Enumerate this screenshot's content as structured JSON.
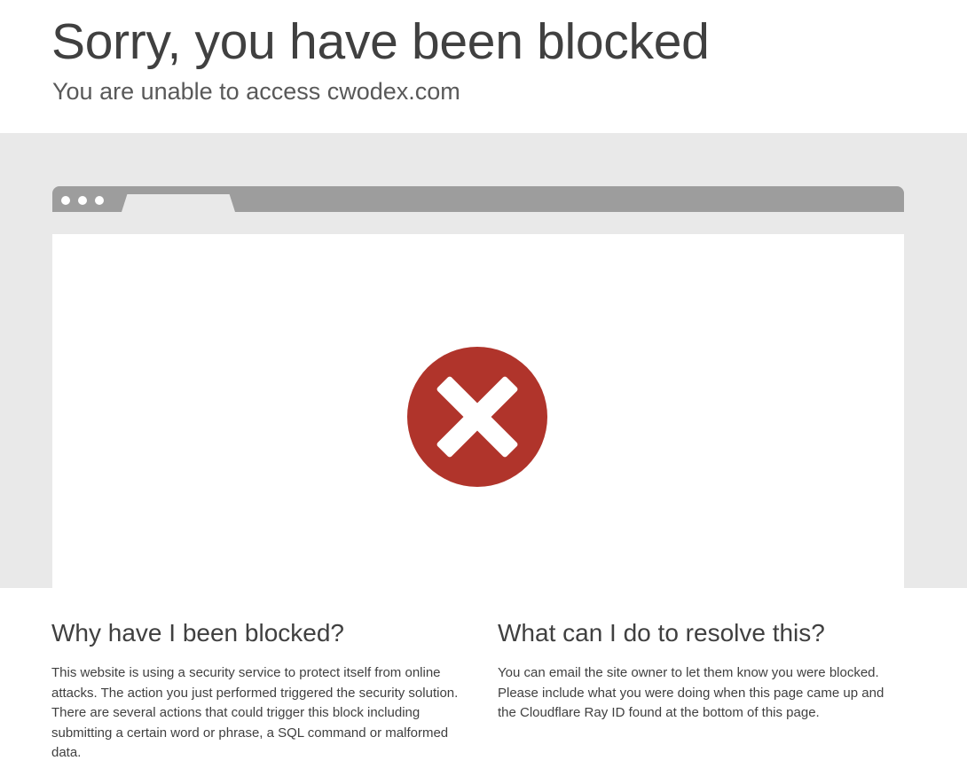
{
  "header": {
    "title": "Sorry, you have been blocked",
    "subtitle": "You are unable to access cwodex.com"
  },
  "browser_illustration": {
    "status_icon": "blocked-x-icon",
    "icon_color": "#b0342b"
  },
  "sections": [
    {
      "heading": "Why have I been blocked?",
      "body": "This website is using a security service to protect itself from online attacks. The action you just performed triggered the security solution. There are several actions that could trigger this block including submitting a certain word or phrase, a SQL command or malformed data."
    },
    {
      "heading": "What can I do to resolve this?",
      "body": "You can email the site owner to let them know you were blocked. Please include what you were doing when this page came up and the Cloudflare Ray ID found at the bottom of this page."
    }
  ]
}
